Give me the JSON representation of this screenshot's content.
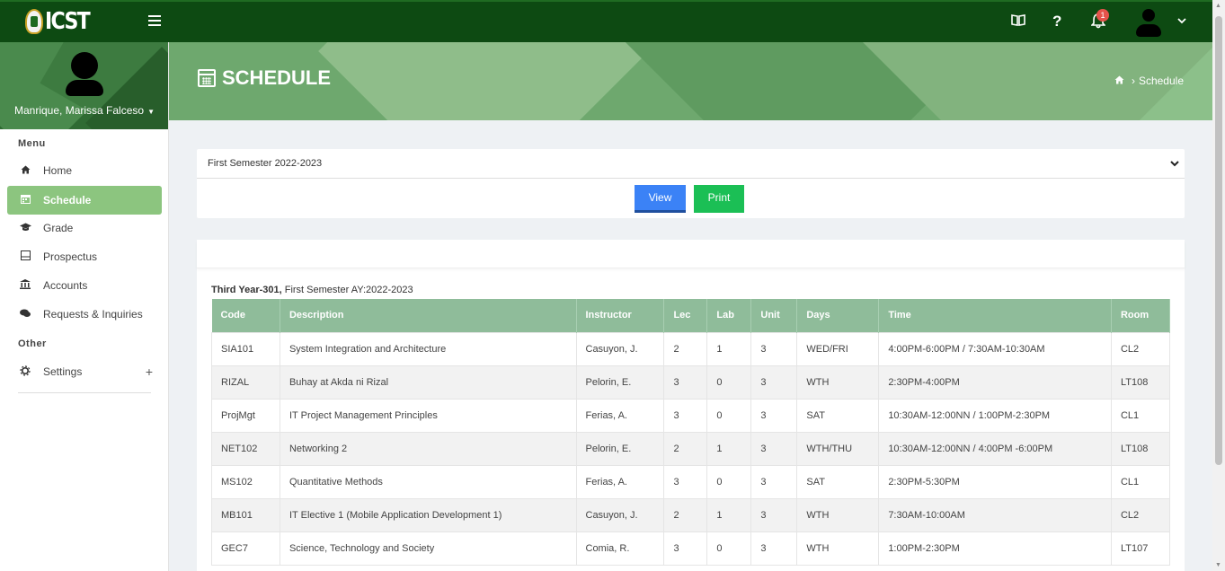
{
  "header": {
    "logo_text": "ICST",
    "icons": {
      "guide": "book-icon",
      "help": "question-icon",
      "notifications": "bell-icon",
      "account": "user-icon"
    },
    "help_glyph": "?",
    "notification_count": "1"
  },
  "profile": {
    "name": "Manrique, Marissa Falceso"
  },
  "sidebar": {
    "menu_heading": "Menu",
    "items": [
      {
        "label": "Home",
        "icon": "home-icon"
      },
      {
        "label": "Schedule",
        "icon": "calendar-icon",
        "active": true
      },
      {
        "label": "Grade",
        "icon": "graduation-cap-icon"
      },
      {
        "label": "Prospectus",
        "icon": "book-open-icon"
      },
      {
        "label": "Accounts",
        "icon": "bank-icon"
      },
      {
        "label": "Requests & Inquiries",
        "icon": "chat-icon"
      }
    ],
    "other_heading": "Other",
    "settings_label": "Settings",
    "settings_expand": "+"
  },
  "banner": {
    "title": "SCHEDULE",
    "breadcrumb": [
      "Schedule"
    ]
  },
  "semester": {
    "selected": "First Semester 2022-2023",
    "view_label": "View",
    "print_label": "Print"
  },
  "schedule": {
    "caption_bold": "Third Year-301,",
    "caption_rest": " First Semester AY:2022-2023",
    "columns": [
      "Code",
      "Description",
      "Instructor",
      "Lec",
      "Lab",
      "Unit",
      "Days",
      "Time",
      "Room"
    ],
    "rows": [
      [
        "SIA101",
        "System Integration and Architecture",
        "Casuyon, J.",
        "2",
        "1",
        "3",
        "WED/FRI",
        "4:00PM-6:00PM / 7:30AM-10:30AM",
        "CL2"
      ],
      [
        "RIZAL",
        "Buhay at Akda ni Rizal",
        "Pelorin, E.",
        "3",
        "0",
        "3",
        "WTH",
        "2:30PM-4:00PM",
        "LT108"
      ],
      [
        "ProjMgt",
        "IT Project Management Principles",
        "Ferias, A.",
        "3",
        "0",
        "3",
        "SAT",
        "10:30AM-12:00NN / 1:00PM-2:30PM",
        "CL1"
      ],
      [
        "NET102",
        "Networking 2",
        "Pelorin, E.",
        "2",
        "1",
        "3",
        "WTH/THU",
        "10:30AM-12:00NN / 4:00PM -6:00PM",
        "LT108"
      ],
      [
        "MS102",
        "Quantitative Methods",
        "Ferias, A.",
        "3",
        "0",
        "3",
        "SAT",
        "2:30PM-5:30PM",
        "CL1"
      ],
      [
        "MB101",
        "IT Elective 1 (Mobile Application Development 1)",
        "Casuyon, J.",
        "2",
        "1",
        "3",
        "WTH",
        "7:30AM-10:00AM",
        "CL2"
      ],
      [
        "GEC7",
        "Science, Technology and Society",
        "Comia, R.",
        "3",
        "0",
        "3",
        "WTH",
        "1:00PM-2:30PM",
        "LT107"
      ]
    ]
  }
}
